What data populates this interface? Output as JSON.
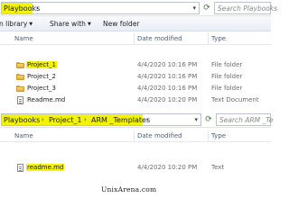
{
  "window1": {
    "breadcrumb": [
      "Playbooks"
    ],
    "search_placeholder": "Search Playbooks",
    "toolbar": {
      "library": "n library",
      "share_with": "Share with",
      "new_folder": "New folder"
    },
    "columns": {
      "name": "Name",
      "date": "Date modified",
      "type": "Type"
    },
    "files": [
      {
        "name": "Project_1",
        "date": "4/4/2020 10:16 PM",
        "type": "File folder",
        "icon": "folder-icon",
        "highlight": true
      },
      {
        "name": "Project_2",
        "date": "4/4/2020 10:16 PM",
        "type": "File folder",
        "icon": "folder-icon",
        "highlight": false
      },
      {
        "name": "Project_3",
        "date": "4/4/2020 10:16 PM",
        "type": "File folder",
        "icon": "folder-icon",
        "highlight": false
      },
      {
        "name": "Readme.md",
        "date": "4/4/2020 10:20 PM",
        "type": "Text Document",
        "icon": "text-document-icon",
        "highlight": false
      }
    ]
  },
  "window2": {
    "breadcrumb": [
      "Playbooks",
      "Project_1",
      "ARM _Templates"
    ],
    "search_placeholder": "Search ARM _Te",
    "columns": {
      "name": "Name",
      "date": "Date modified",
      "type": "Type"
    },
    "files": [
      {
        "name": "readme.md",
        "date": "4/4/2020 10:20 PM",
        "type": "Text",
        "icon": "text-document-icon",
        "highlight": true
      }
    ]
  },
  "watermark": "UnixArena.com",
  "colors": {
    "highlight": "#f2f20d",
    "header_text": "#4c607a",
    "meta_text": "#6d6d6d"
  }
}
